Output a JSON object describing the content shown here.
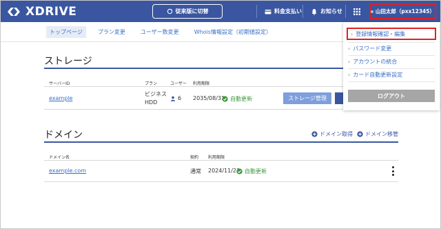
{
  "header": {
    "logo_text": "XDRIVE",
    "switch_label": "従来版に切替",
    "payment_label": "料金支払い",
    "notice_label": "お知らせ",
    "user_label": "山田太郎（pxx12345）",
    "brand_color": "#3a56a0"
  },
  "tabs": [
    "トップページ",
    "プラン変更",
    "ユーザー数変更",
    "Whois情報設定（初期値設定）"
  ],
  "storage": {
    "title": "ストレージ",
    "columns": {
      "server_id": "サーバーID",
      "plan": "プラン",
      "users": "ユーザー",
      "period": "利用期限"
    },
    "row": {
      "server_id": "example",
      "plan_line1": "ビジネス",
      "plan_line2": "HDD",
      "users": "6",
      "period": "2035/08/31",
      "auto_renew": "自動更新",
      "manage_button": "ストレージ管理"
    }
  },
  "domain": {
    "title": "ドメイン",
    "add_acquire": "ドメイン取得",
    "add_transfer": "ドメイン移管",
    "columns": {
      "name": "ドメイン名",
      "contract": "契約",
      "period": "利用期限"
    },
    "row": {
      "name": "example.com",
      "contract": "通常",
      "period": "2024/11/23",
      "auto_renew": "自動更新"
    }
  },
  "dropdown": {
    "items": [
      "登録情報確認・編集",
      "パスワード変更",
      "アカウントの統合",
      "カード自動更新設定"
    ],
    "logout": "ログアウト"
  }
}
